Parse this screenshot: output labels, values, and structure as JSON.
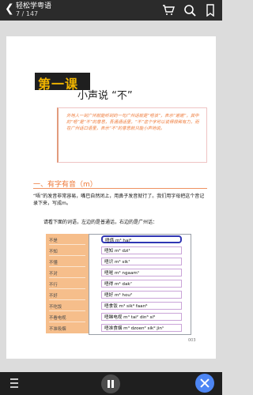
{
  "top_bar": {
    "title": "轻松学粤语",
    "page_counter": "7 / 147"
  },
  "icons": {
    "back": "back-arrow-icon",
    "cart": "cart-icon",
    "search": "search-icon",
    "bookmark": "bookmark-icon",
    "menu": "menu-icon",
    "pause": "pause-icon",
    "close": "close-icon"
  },
  "content": {
    "lesson_title": "第一课",
    "subtitle": "小声说 “不”",
    "intro_text": "外地人一到广州就能听到的一句广州话就是“唔该”，表示“谢谢”，其中的“唔”是“不”的意思，吾通通话里，“不”这个字可以说得很稀有力，而在广州话口语里，表示“不”的意思就只能小声地说。",
    "section_title": "一、有字有音（m）",
    "paragraph_1": "“唔”的发音非常容易，嘴巴自然闭上，用鼻子发音就行了。我们用字母把这个音记录下来，写成m。",
    "instruction": "请看下面的词语，左边的是普通话，右边的是广州话：",
    "phrases": [
      {
        "mandarin": "不是",
        "cantonese": "唔係 m⁴ hai⁶"
      },
      {
        "mandarin": "不知",
        "cantonese": "唔知 m⁴ dzi¹"
      },
      {
        "mandarin": "不懂",
        "cantonese": "唔识 m⁴ sik⁷"
      },
      {
        "mandarin": "不对",
        "cantonese": "唔啱 m⁴ ngaam¹"
      },
      {
        "mandarin": "不行",
        "cantonese": "唔得 m⁴ dak⁷"
      },
      {
        "mandarin": "不好",
        "cantonese": "唔好 m⁴ hou²"
      },
      {
        "mandarin": "不吃饭",
        "cantonese": "唔食饭 m⁴ sik⁹ faan⁶"
      },
      {
        "mandarin": "不看电视",
        "cantonese": "唔睇电视 m⁴ tai² din⁶ si⁶"
      },
      {
        "mandarin": "不准吸烟",
        "cantonese": "唔准食烟 m⁴ dzoen² sik⁹ jin¹"
      }
    ],
    "page_number": "003"
  },
  "colors": {
    "accent": "#ee7a3a",
    "phrase_panel": "#f6be8b",
    "selection": "#2f35b3",
    "close": "#4d86f4"
  }
}
